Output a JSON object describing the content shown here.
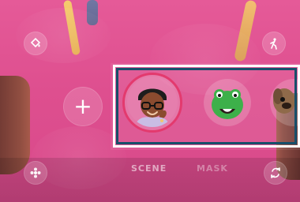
{
  "bottom": {
    "modes": [
      "SCENE",
      "MASK"
    ]
  },
  "icons": {
    "top_left": "paint-bucket-icon",
    "top_right": "walking-person-icon",
    "bottom_left": "flower-icon",
    "bottom_right": "switch-camera-icon",
    "add": "plus-icon"
  },
  "stickers": [
    {
      "name": "emoji-avatar"
    },
    {
      "name": "green-dinosaur"
    },
    {
      "name": "dog-avatar"
    }
  ]
}
